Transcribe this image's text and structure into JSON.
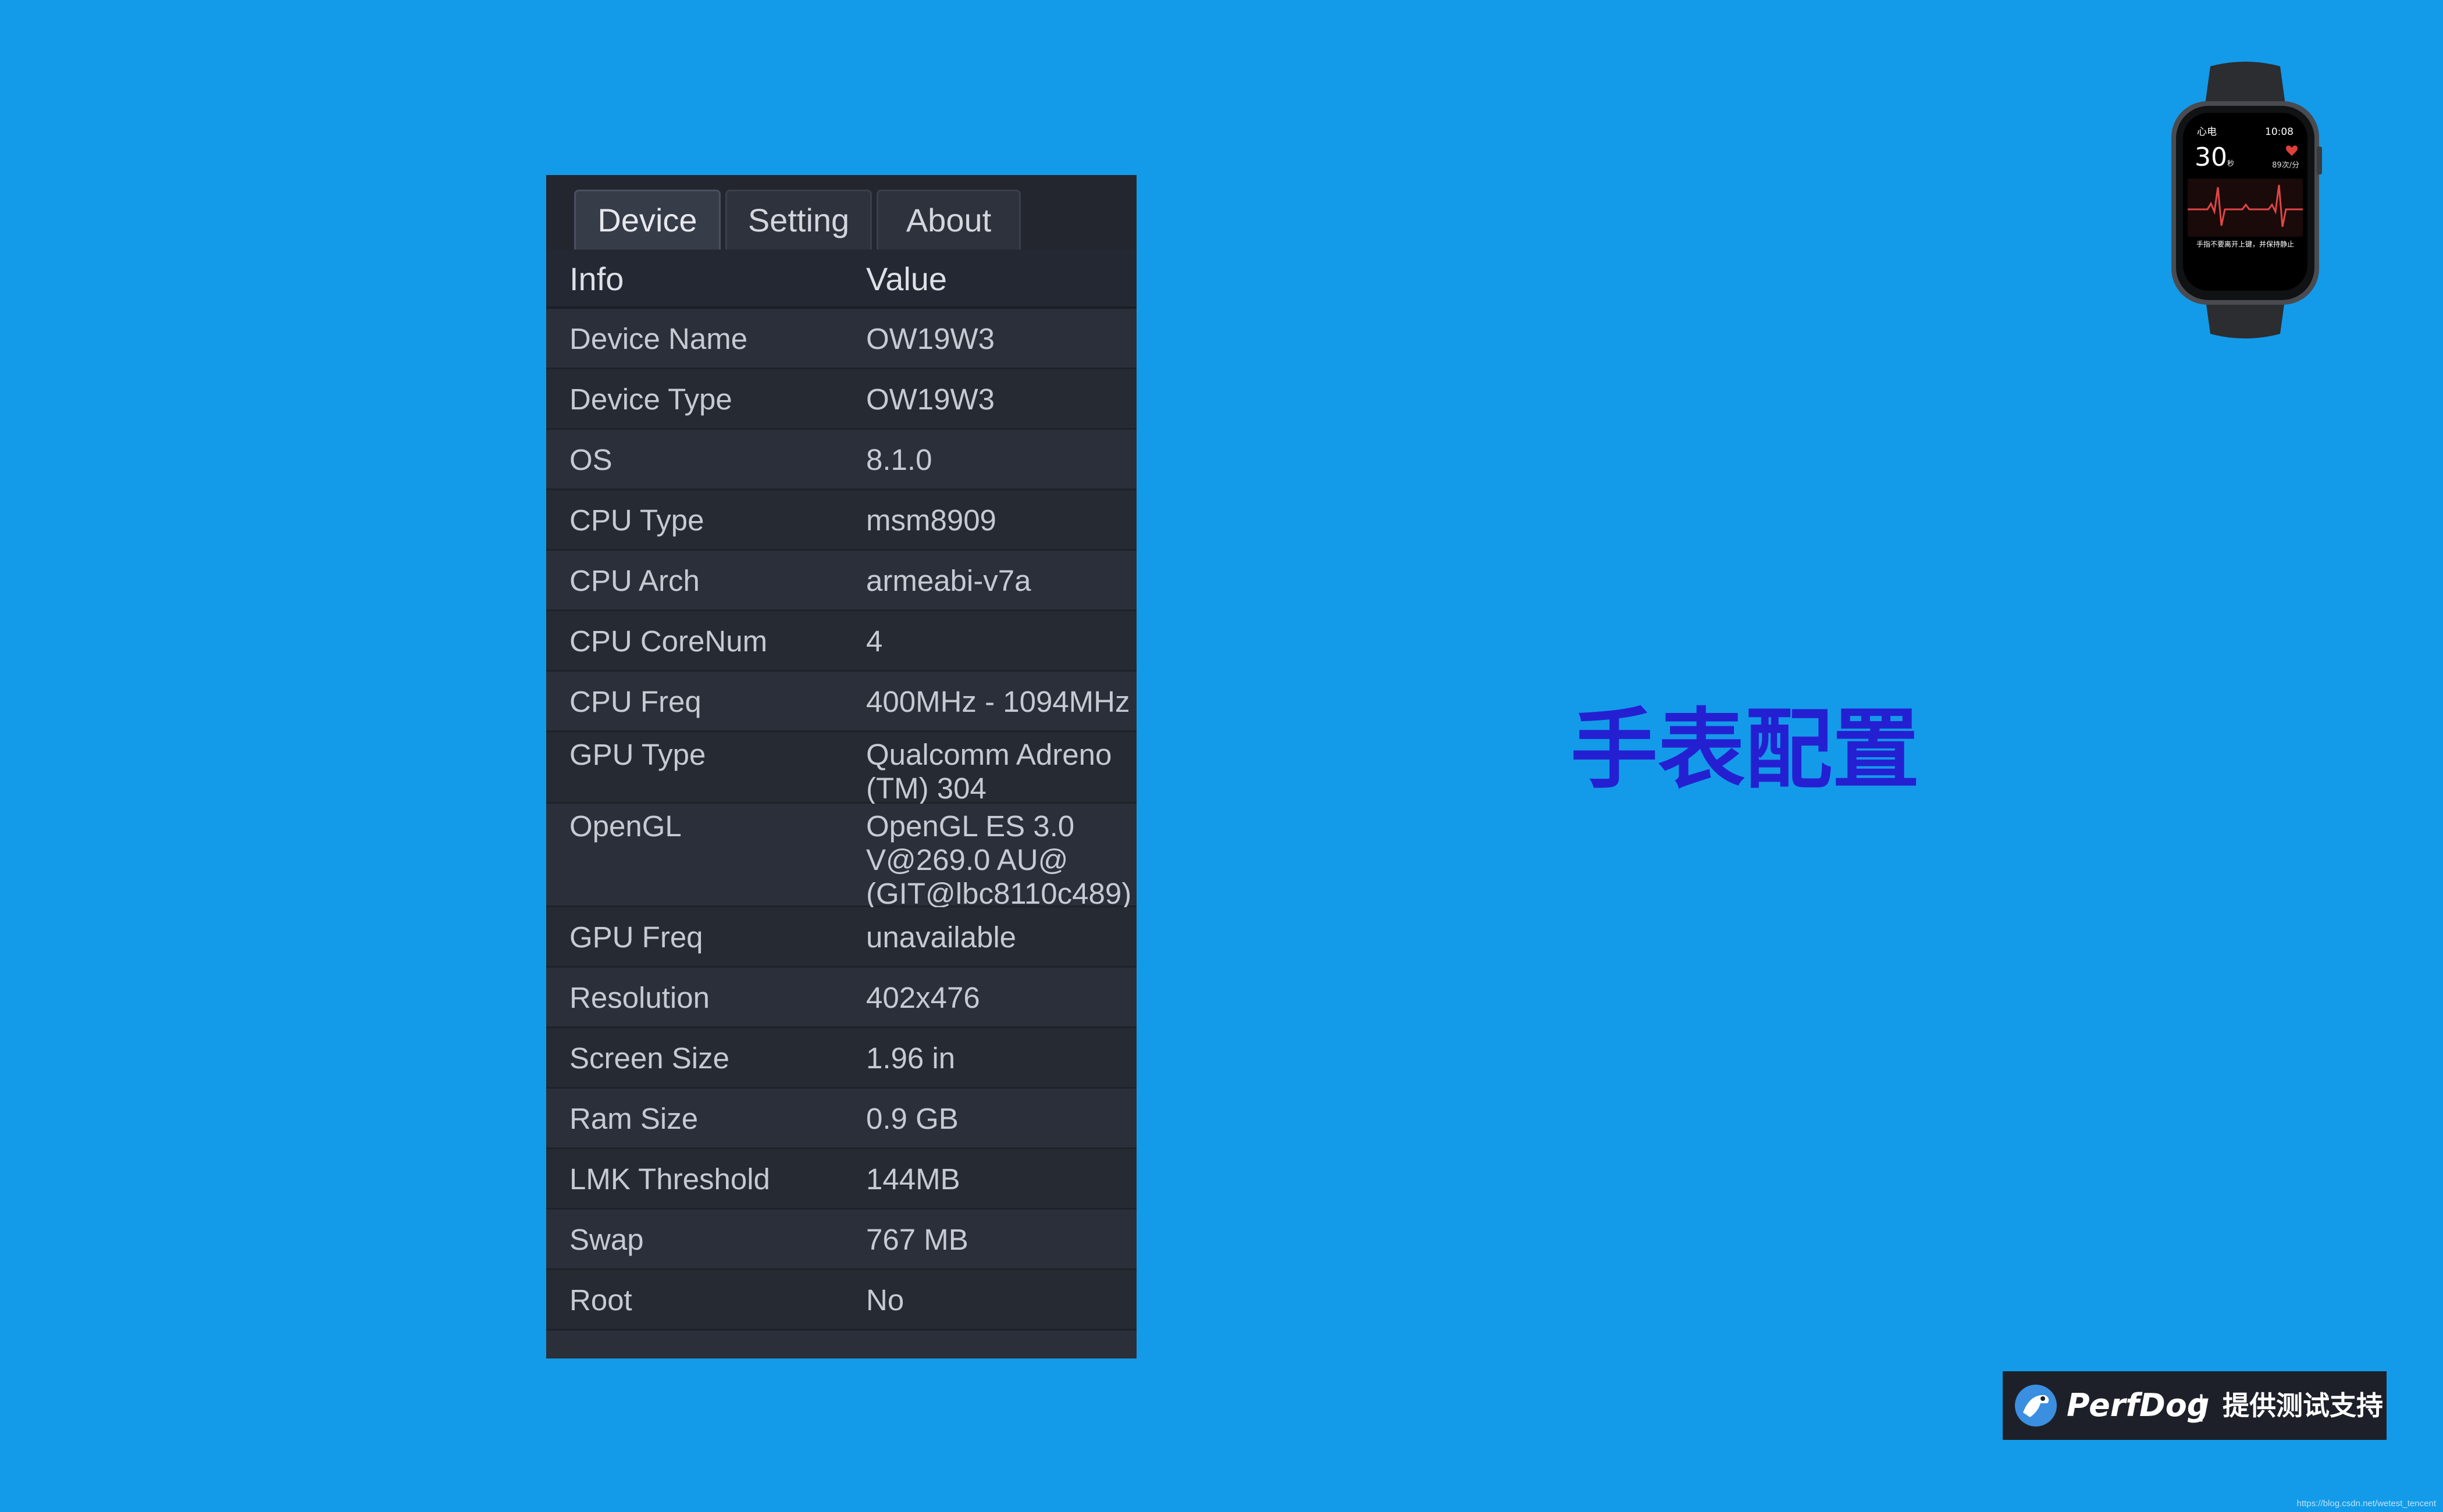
{
  "tabs": [
    {
      "label": "Device",
      "active": true
    },
    {
      "label": "Setting",
      "active": false
    },
    {
      "label": "About",
      "active": false
    }
  ],
  "table": {
    "headers": [
      "Info",
      "Value"
    ],
    "rows": [
      {
        "key": "Device Name",
        "value": "OW19W3"
      },
      {
        "key": "Device Type",
        "value": "OW19W3"
      },
      {
        "key": "OS",
        "value": "8.1.0"
      },
      {
        "key": "CPU Type",
        "value": "msm8909"
      },
      {
        "key": "CPU Arch",
        "value": "armeabi-v7a"
      },
      {
        "key": "CPU CoreNum",
        "value": "4"
      },
      {
        "key": "CPU Freq",
        "value": "400MHz - 1094MHz"
      },
      {
        "key": "GPU Type",
        "value": "Qualcomm Adreno (TM) 304"
      },
      {
        "key": "OpenGL",
        "value": "OpenGL ES 3.0 V@269.0 AU@ (GIT@lbc8110c489)"
      },
      {
        "key": "GPU Freq",
        "value": "unavailable"
      },
      {
        "key": "Resolution",
        "value": "402x476"
      },
      {
        "key": "Screen Size",
        "value": "1.96 in"
      },
      {
        "key": "Ram Size",
        "value": "0.9 GB"
      },
      {
        "key": "LMK Threshold",
        "value": "144MB"
      },
      {
        "key": "Swap",
        "value": "767 MB"
      },
      {
        "key": "Root",
        "value": "No"
      }
    ]
  },
  "title": "手表配置",
  "watch": {
    "label": "心电",
    "time": "10:08",
    "seconds": "30",
    "seconds_unit": "秒",
    "heart_rate": "89次/分",
    "hint": "手指不要离开上键，并保持静止"
  },
  "badge": {
    "brand": "PerfDog",
    "separator": "|",
    "text": "提供测试支持"
  },
  "footer_url": "https://blog.csdn.net/wetest_tencent",
  "colors": {
    "background": "#139be9",
    "panel": "#262a34",
    "title": "#2420d2",
    "badge": "#1e2029"
  }
}
